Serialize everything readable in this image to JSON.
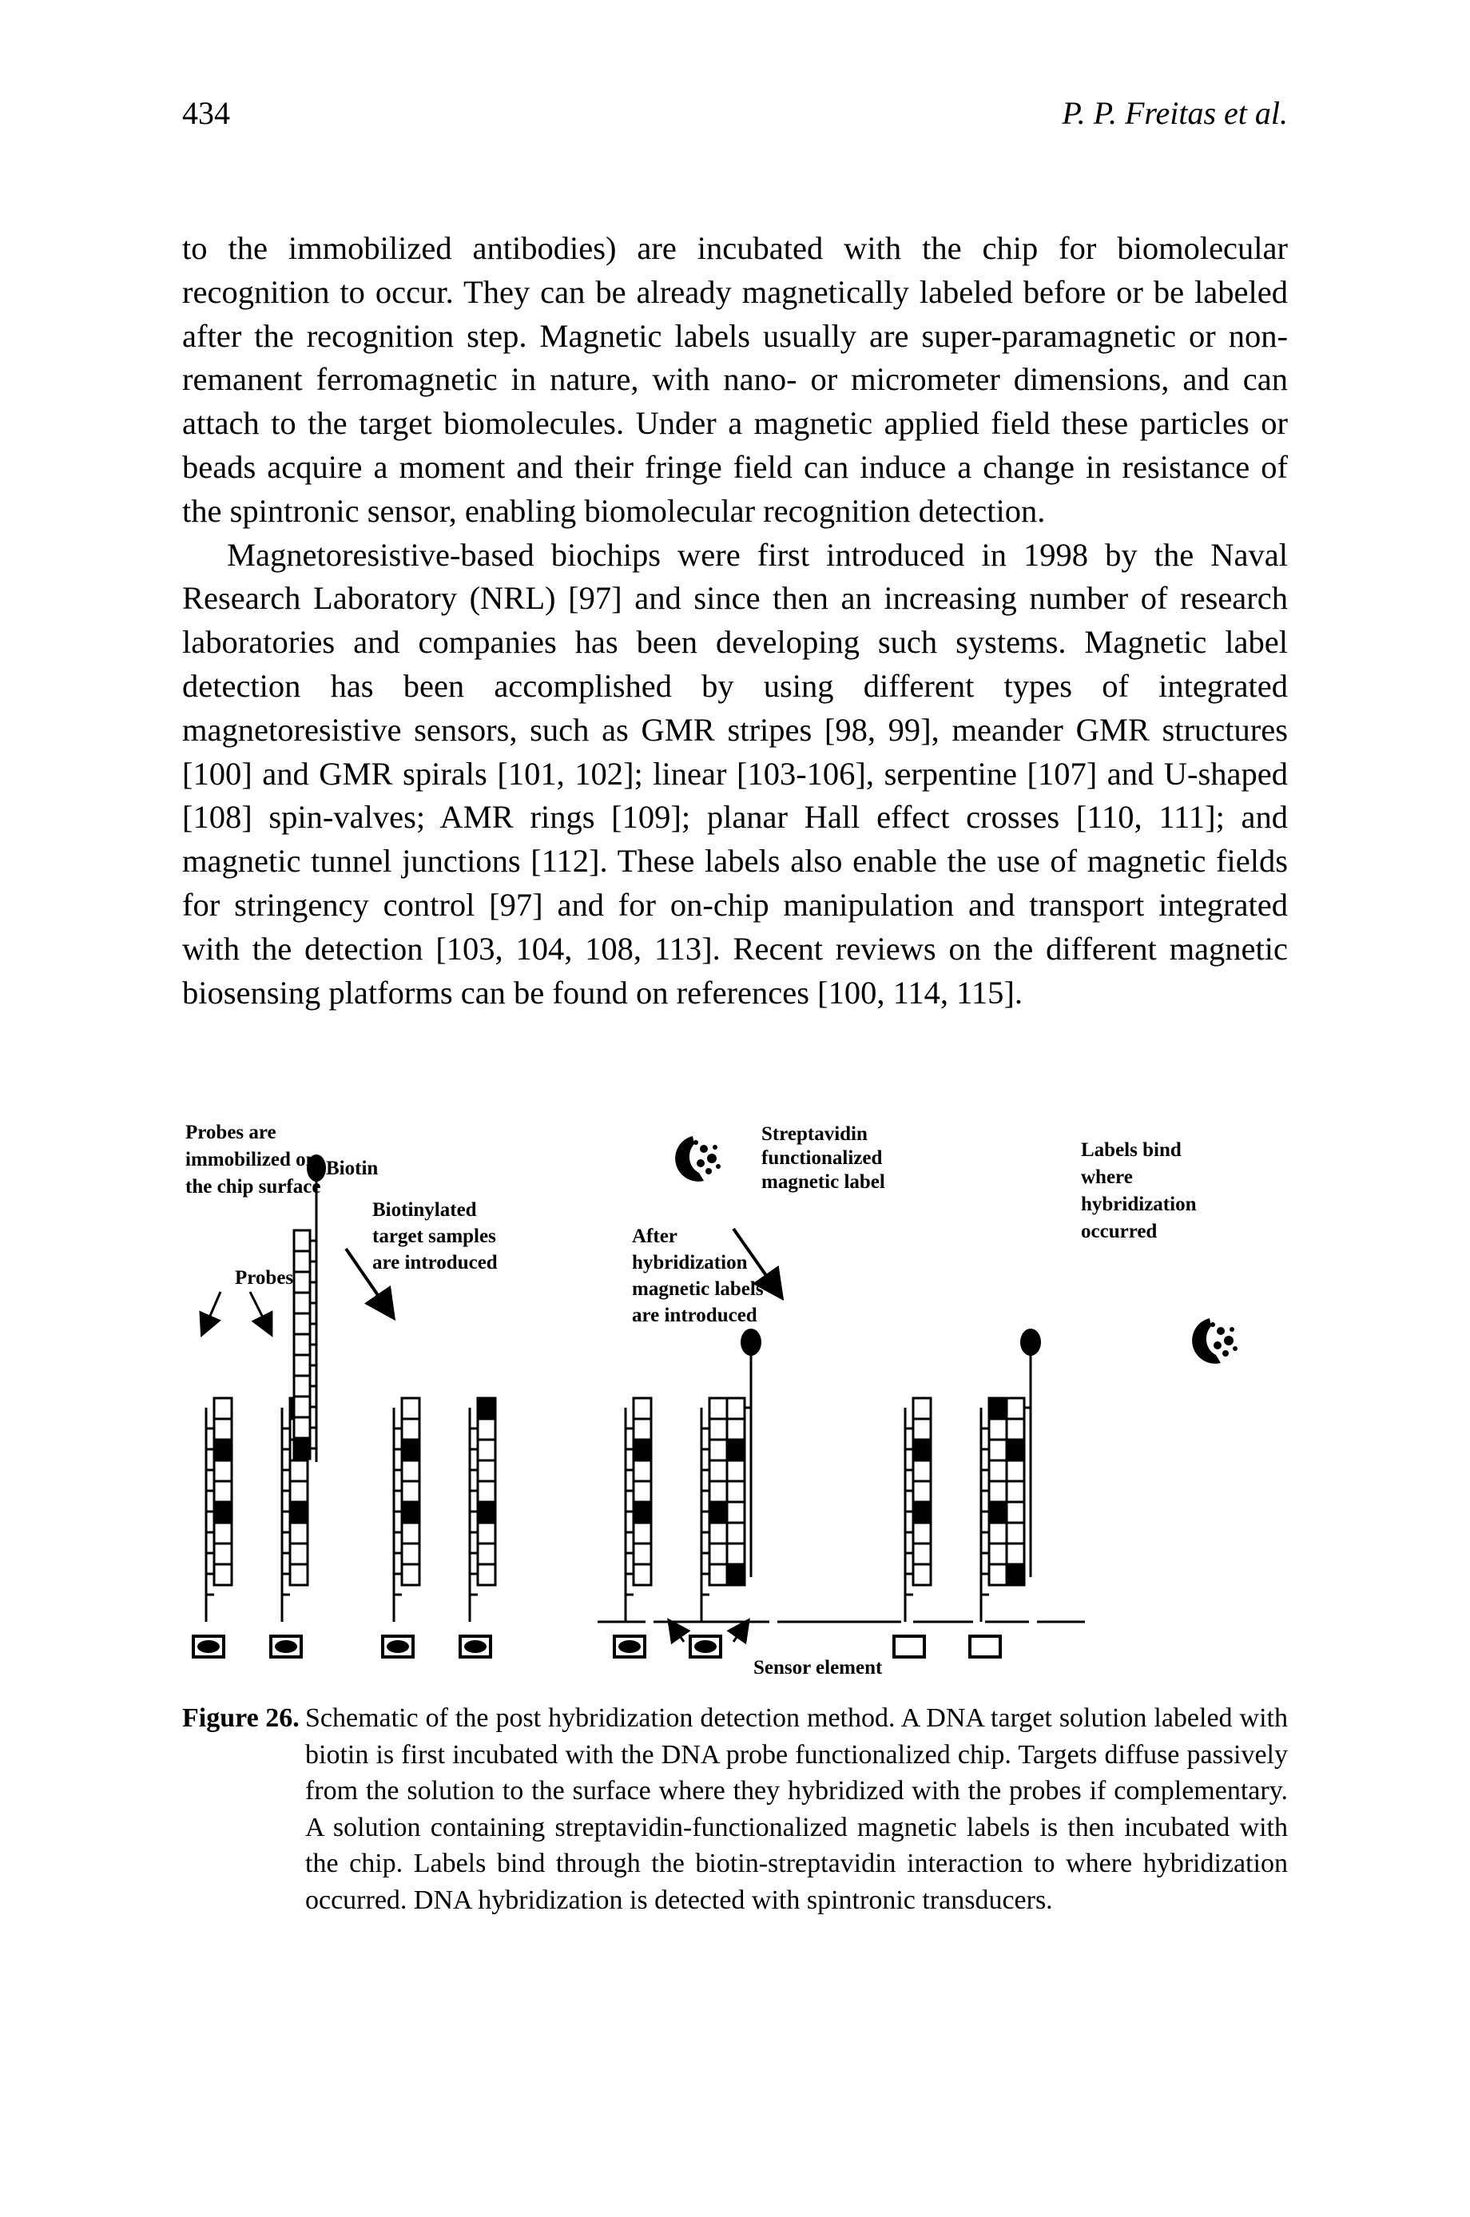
{
  "header": {
    "page_number": "434",
    "running_head": "P. P. Freitas et al."
  },
  "body": {
    "paragraphs": [
      "to the immobilized antibodies) are incubated with the chip for biomolecular recognition to occur. They can be already magnetically labeled before or be labeled after the recognition step. Magnetic labels usually are super-paramagnetic or non-remanent ferromagnetic in nature, with nano- or micrometer dimensions, and can attach to the target biomolecules. Under a magnetic applied field these particles or beads acquire a moment and their fringe field can induce a change in resistance of the spintronic sensor, enabling biomolecular recognition detection.",
      "Magnetoresistive-based biochips were first introduced in 1998 by the Naval Research Laboratory (NRL) [97] and since then an increasing number of research laboratories and companies has been developing such systems. Magnetic label detection has been accomplished by using different types of integrated magnetoresistive sensors, such as GMR stripes [98, 99], meander GMR structures [100] and GMR spirals [101, 102]; linear [103-106], serpentine [107] and U-shaped [108] spin-valves; AMR rings [109]; planar Hall effect crosses [110, 111]; and magnetic tunnel junctions [112]. These labels also enable the use of magnetic fields for stringency control [97] and for on-chip manipulation and transport integrated with the detection [103, 104, 108, 113]. Recent reviews on the different magnetic biosensing platforms can be found on references [100, 114, 115]."
    ]
  },
  "figure": {
    "labels": {
      "probes_immobilized": [
        "Probes are",
        "immobilized on",
        "the chip surface"
      ],
      "probes": "Probes",
      "biotin": "Biotin",
      "biotinylated": [
        "Biotinylated",
        "target samples",
        "are introduced"
      ],
      "streptavidin": [
        "Streptavidin",
        "functionalized",
        "magnetic label"
      ],
      "after_hybridization": [
        "After",
        "hybridization",
        "magnetic labels",
        "are introduced"
      ],
      "labels_bind": [
        "Labels bind",
        "where",
        "hybridization",
        "occurred"
      ],
      "sensor_element": "Sensor element"
    }
  },
  "caption": {
    "title": "Figure 26.",
    "text": "Schematic of the post hybridization detection method. A DNA target solution labeled with biotin is first incubated with the DNA probe functionalized chip. Targets diffuse passively from the solution to the surface where they hybridized with the probes if complementary. A solution containing streptavidin-functionalized magnetic labels is then incubated with the chip. Labels bind through the biotin-streptavidin interaction to where hybridization occurred. DNA hybridization is detected with spintronic transducers."
  }
}
